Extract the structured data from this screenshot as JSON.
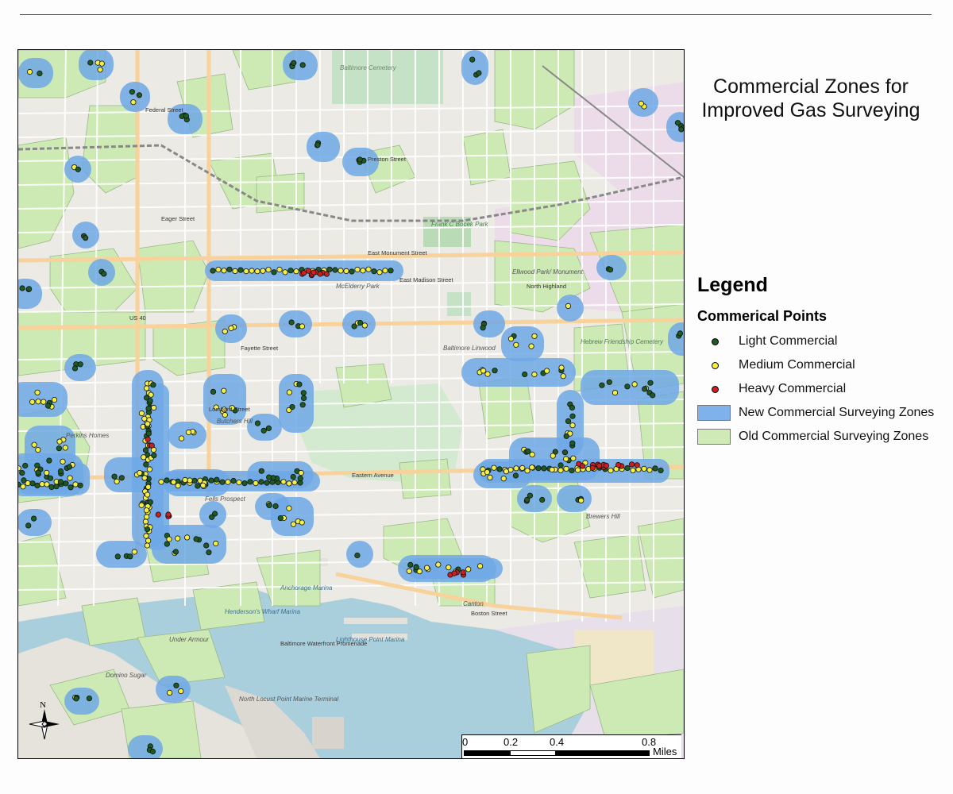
{
  "map": {
    "title_line1": "Commercial Zones for",
    "title_line2": "Improved Gas Surveying",
    "colors": {
      "water": "#aacfdc",
      "land": "#eceae4",
      "roads": "#ffffff",
      "major_roads": "#f8d29a",
      "old_zone": "#cde9b4",
      "new_zone": "#6fa8e6",
      "light": "#1e5a22",
      "medium": "#f4ee45",
      "heavy": "#cc1f1f"
    },
    "place_labels": [
      "Baltimore Cemetery",
      "Frank C Bocek Park",
      "Perkins Homes",
      "Butchers Hill",
      "Fells Prospect",
      "Canton",
      "Brewers Hill",
      "Ellwood Park/ Monument",
      "McElderry Park",
      "Baltimore Linwood",
      "Hebrew Friendship Cemetery",
      "Anchorage Marina",
      "Lighthouse Point Marina",
      "Henderson's Wharf Marina",
      "North Locust Point Marine Terminal",
      "Domino Sugar",
      "Under Armour"
    ],
    "street_labels": [
      "East Monument Street",
      "Eastern Avenue",
      "Boston Street",
      "US 40",
      "Lombard Street",
      "Fayette Street",
      "Preston Street",
      "Eager Street",
      "Federal Street",
      "East Madison Street",
      "North Highland",
      "Baltimore Waterfront Promenade"
    ]
  },
  "legend": {
    "heading": "Legend",
    "points_heading": "Commerical Points",
    "items": [
      {
        "label": "Light Commercial",
        "kind": "dot",
        "color": "#1e5a22"
      },
      {
        "label": "Medium Commercial",
        "kind": "dot",
        "color": "#f4ee45"
      },
      {
        "label": "Heavy Commercial",
        "kind": "dot",
        "color": "#cc1f1f"
      },
      {
        "label": "New Commercial Surveying Zones",
        "kind": "box",
        "color": "#7fb2ea"
      },
      {
        "label": "Old Commercial Surveying Zones",
        "kind": "box",
        "color": "#cfeab6"
      }
    ]
  },
  "scalebar": {
    "ticks": [
      "0",
      "0.2",
      "0.4",
      "0.8"
    ],
    "unit": "Miles"
  },
  "north_arrow": {
    "label": "N"
  }
}
